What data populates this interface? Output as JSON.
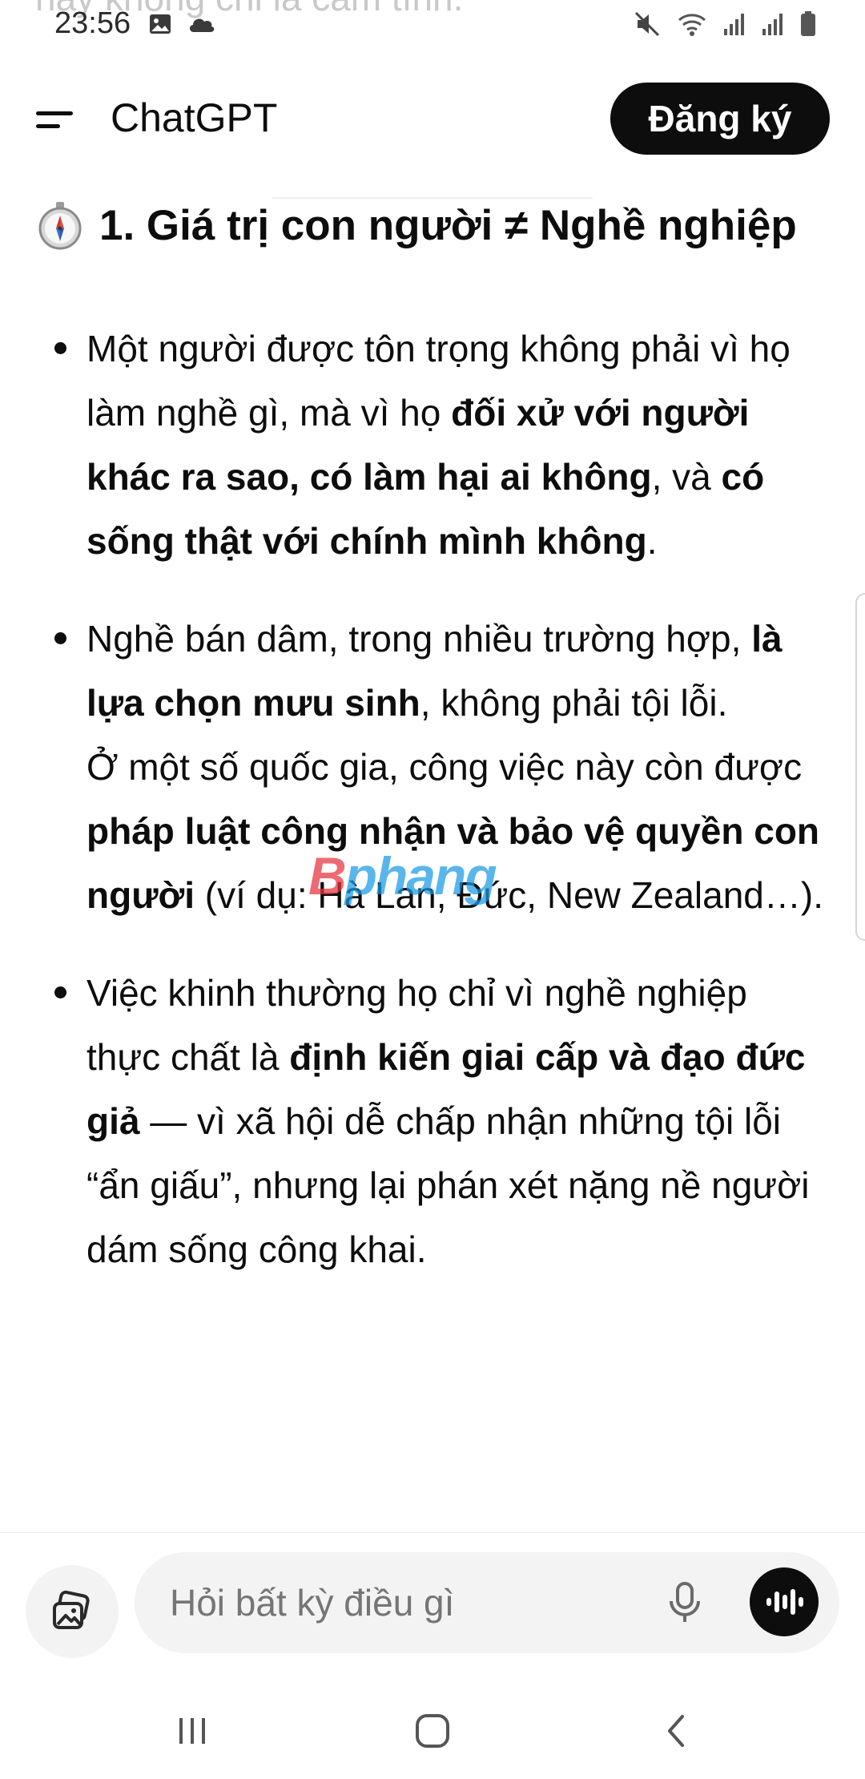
{
  "ghost_text": "này không chỉ là cảm tính.",
  "status_bar": {
    "time": "23:56",
    "left_icons": [
      "gallery-icon",
      "cloud-icon"
    ],
    "right_icons": [
      "mute-icon",
      "wifi-icon",
      "signal-icon",
      "signal-icon",
      "battery-icon"
    ]
  },
  "header": {
    "menu_icon": "menu-icon",
    "title": "ChatGPT",
    "signup_label": "Đăng ký"
  },
  "content": {
    "heading_icon": "compass-icon",
    "heading": "1. Giá trị con người ≠ Nghề nghiệp",
    "bullets": [
      {
        "segments": [
          {
            "text": "Một người được tôn trọng không phải vì họ làm nghề gì, mà vì họ ",
            "bold": false
          },
          {
            "text": "đối xử với người khác ra sao, có làm hại ai không",
            "bold": true
          },
          {
            "text": ", và ",
            "bold": false
          },
          {
            "text": "có sống thật với chính mình không",
            "bold": true
          },
          {
            "text": ".",
            "bold": false
          }
        ]
      },
      {
        "segments": [
          {
            "text": "Nghề bán dâm, trong nhiều trường hợp, ",
            "bold": false
          },
          {
            "text": "là lựa chọn mưu sinh",
            "bold": true
          },
          {
            "text": ", không phải tội lỗi.",
            "bold": false
          },
          {
            "text": "\n",
            "bold": false
          },
          {
            "text": "Ở một số quốc gia, công việc này còn được ",
            "bold": false
          },
          {
            "text": "pháp luật công nhận và bảo vệ quyền con người",
            "bold": true
          },
          {
            "text": " (ví dụ: Hà Lan, Đức, New Zealand…).",
            "bold": false
          }
        ]
      },
      {
        "segments": [
          {
            "text": "Việc khinh thường họ chỉ vì nghề nghiệp thực chất là ",
            "bold": false
          },
          {
            "text": "định kiến giai cấp và đạo đức giả",
            "bold": true
          },
          {
            "text": " — vì xã hội dễ chấp nhận những tội lỗi “ẩn giấu”, nhưng lại phán xét nặng nề người dám sống công khai.",
            "bold": false
          }
        ]
      }
    ]
  },
  "watermark": {
    "first": "B",
    "rest": "phang"
  },
  "composer": {
    "attach_icon": "attach-image-icon",
    "placeholder": "Hỏi bất kỳ điều gì",
    "mic_icon": "mic-icon",
    "voice_icon": "voice-mode-icon"
  },
  "nav_bar": {
    "icons": [
      "recent-apps-icon",
      "home-icon",
      "back-icon"
    ]
  },
  "colors": {
    "text": "#0d0d0d",
    "button_bg": "#0d0d0d",
    "button_text": "#ffffff",
    "input_bg": "#f3f3f3",
    "placeholder": "#8e8e8e",
    "watermark_red": "#e8323c",
    "watermark_blue": "#1a9be6"
  }
}
